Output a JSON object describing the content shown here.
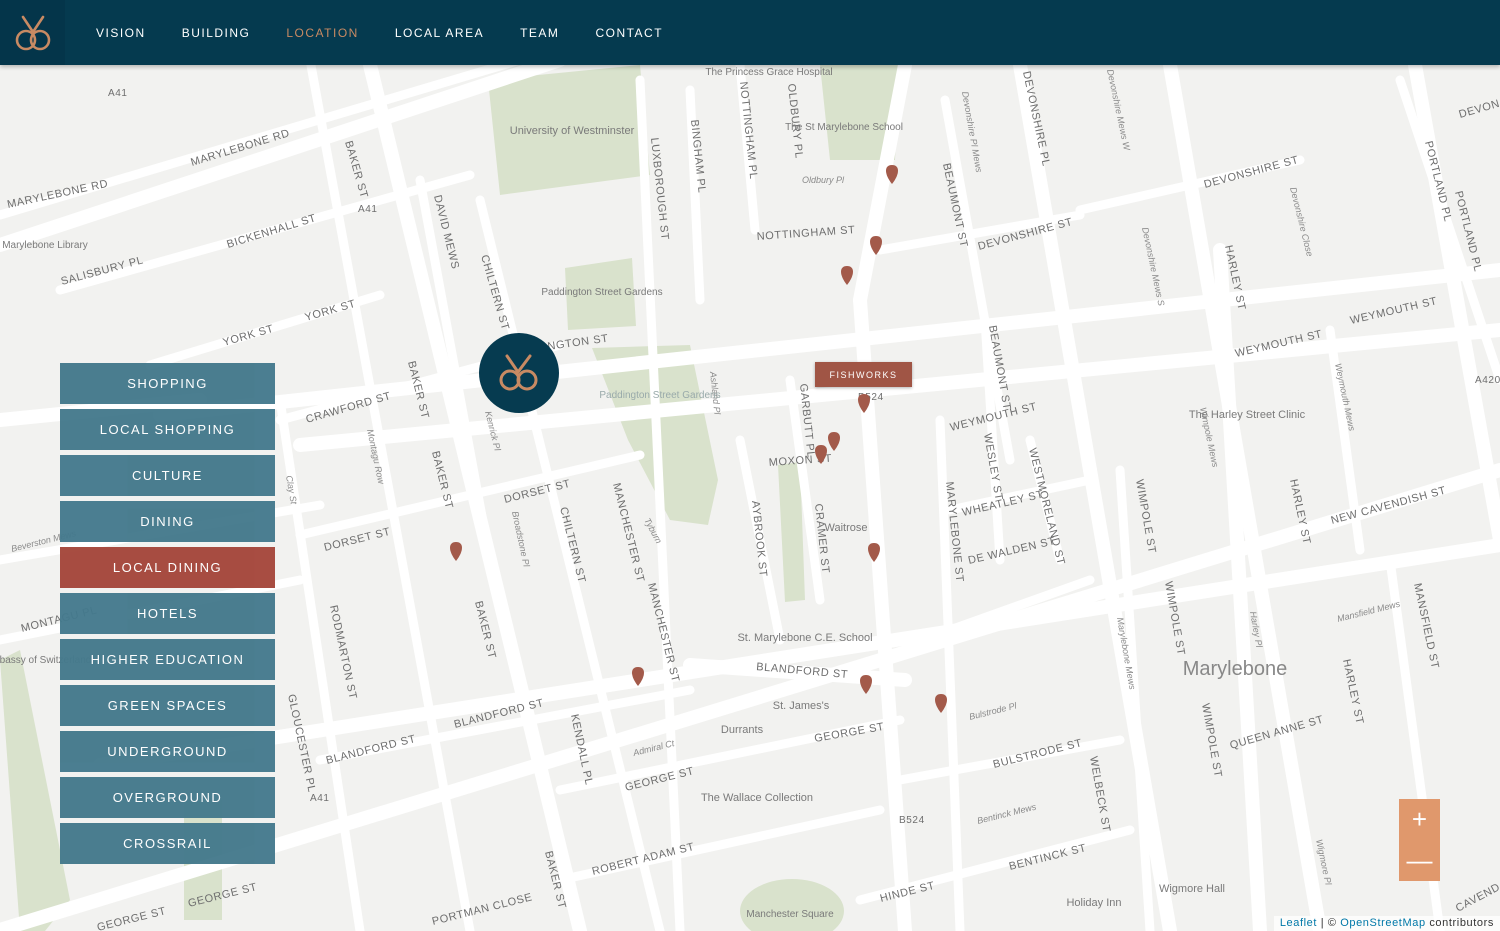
{
  "brand": {
    "logo_icon": "intertwined-rings-logo",
    "accent": "#c88a63",
    "header_bg": "#053a4f"
  },
  "nav": {
    "items": [
      "VISION",
      "BUILDING",
      "LOCATION",
      "LOCAL AREA",
      "TEAM",
      "CONTACT"
    ],
    "active": "LOCATION"
  },
  "categories": {
    "items": [
      "SHOPPING",
      "LOCAL SHOPPING",
      "CULTURE",
      "DINING",
      "LOCAL DINING",
      "HOTELS",
      "HIGHER EDUCATION",
      "GREEN SPACES",
      "UNDERGROUND",
      "OVERGROUND",
      "CROSSRAIL"
    ],
    "active": "LOCAL DINING",
    "bg": "#44798c",
    "active_bg": "#a4463a"
  },
  "popup": {
    "label": "FISHWORKS"
  },
  "zoom": {
    "in": "+",
    "out": "—"
  },
  "attribution": {
    "leaflet": "Leaflet",
    "sep": " | © ",
    "osm": "OpenStreetMap",
    "suffix": " contributors"
  },
  "map_labels": {
    "street": [
      "MARYLEBONE RD",
      "MARYLEBONE RD",
      "BAKER ST",
      "BAKER ST",
      "BAKER ST",
      "BAKER ST",
      "BAKER ST",
      "BICKENHALL ST",
      "SALISBURY PL",
      "YORK ST",
      "YORK ST",
      "CRAWFORD ST",
      "DORSET ST",
      "DORSET ST",
      "DAVID MEWS",
      "CHILTERN ST",
      "CHILTERN ST",
      "NGTON ST",
      "LUXBOROUGH ST",
      "BINGHAM PL",
      "NOTTINGHAM PL",
      "OLDBURY PL",
      "NOTTINGHAM ST",
      "DEVONSHIRE PL",
      "BEAUMONT ST",
      "BEAUMONT ST",
      "DEVONSHIRE ST",
      "DEVONSHIRE ST",
      "HARLEY ST",
      "HARLEY ST",
      "HARLEY ST",
      "PORTLAND PL",
      "PORTLAND PL",
      "WEYMOUTH ST",
      "WEYMOUTH ST",
      "WEYMOUTH ST",
      "GARBUTT PL",
      "MOXON ST",
      "CRAMER ST",
      "AYBROOK ST",
      "MANCHESTER ST",
      "MANCHESTER ST",
      "MARYLEBONE ST",
      "WESLEY ST",
      "WESTMORELAND ST",
      "WHEATLEY ST",
      "DE WALDEN ST",
      "WIMPOLE ST",
      "WIMPOLE ST",
      "WIMPOLE ST",
      "NEW CAVENDISH ST",
      "BLANDFORD ST",
      "BLANDFORD ST",
      "BLANDFORD ST",
      "GEORGE ST",
      "GEORGE ST",
      "GEORGE ST",
      "GEORGE ST",
      "BULSTRODE ST",
      "QUEEN ANNE ST",
      "WELBECK ST",
      "BENTINCK ST",
      "HINDE ST",
      "ROBERT ADAM ST",
      "PORTMAN CLOSE",
      "GLOUCESTER PL",
      "RODMARTON ST",
      "KENDALL PL",
      "MONTAGU PL",
      "MANSFIELD ST",
      "DEVON",
      "CAVEND",
      "A41",
      "A41",
      "A41",
      "B524",
      "B524",
      "A420"
    ],
    "minor": [
      "Kenrick Pl",
      "Montagu Row",
      "Clay St",
      "Broadstone Pl",
      "Ashland Pl",
      "Tyburn",
      "Devonshire Pl Mews",
      "Devonshire Mews W",
      "Devonshire Mews S",
      "Devonshire Close",
      "Wimpole Mews",
      "Weymouth Mews",
      "Marylebone Mews",
      "Harley Pl",
      "Mansfield Mews",
      "Bulstrode Pl",
      "Bentinck Mews",
      "Admiral Ct",
      "Oldbury Pl",
      "Beverston Mews",
      "Wigmore Pl"
    ],
    "place": [
      "University of Westminster",
      "The Princess Grace Hospital",
      "The St Marylebone School",
      "Marylebone Library",
      "Paddington Street Gardens",
      "Paddington Street Gardens",
      "Waitrose",
      "St. Marylebone C.E. School",
      "St. James's",
      "Durrants",
      "The Wallace Collection",
      "The Harley Street Clinic",
      "Marylebone",
      "Wigmore Hall",
      "Holiday Inn",
      "Embassy of Switzerland",
      "Manchester Square"
    ]
  }
}
